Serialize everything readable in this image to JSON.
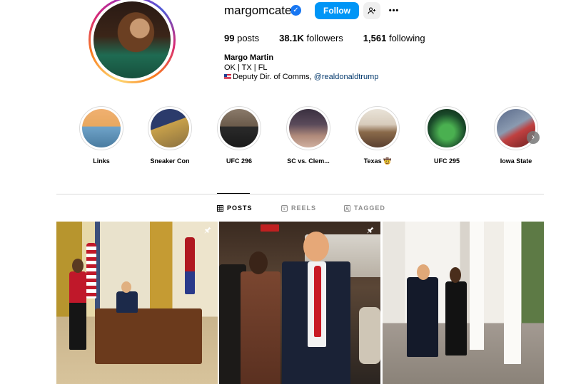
{
  "profile": {
    "username": "margomcatee",
    "verified_glyph": "✓",
    "follow_label": "Follow",
    "more_glyph": "•••",
    "stats": [
      {
        "count": "99",
        "label": "posts"
      },
      {
        "count": "38.1K",
        "label": "followers"
      },
      {
        "count": "1,561",
        "label": "following"
      }
    ],
    "bio": {
      "name": "Margo Martin",
      "line1": "OK | TX | FL",
      "line2_prefix": "Deputy Dir. of Comms, ",
      "line2_link": "@realdonaldtrump"
    }
  },
  "highlights": [
    {
      "label": "Links",
      "colors": [
        "#e8a860",
        "#6fa3c9"
      ]
    },
    {
      "label": "Sneaker Con",
      "colors": [
        "#2b3b6b",
        "#c8a14a"
      ]
    },
    {
      "label": "UFC 296",
      "colors": [
        "#6a5a4a",
        "#2a2a2a"
      ]
    },
    {
      "label": "SC vs. Clem...",
      "colors": [
        "#3a3040",
        "#b08a7a"
      ]
    },
    {
      "label": "Texas 🤠",
      "colors": [
        "#e9e3d8",
        "#8a6a4a"
      ]
    },
    {
      "label": "UFC 295",
      "colors": [
        "#1a4a2a",
        "#4ab050"
      ]
    },
    {
      "label": "Iowa State",
      "colors": [
        "#5a6a8a",
        "#c04040"
      ]
    }
  ],
  "tabs": [
    {
      "label": "POSTS",
      "icon": "grid-icon",
      "active": true
    },
    {
      "label": "REELS",
      "icon": "reels-icon",
      "active": false
    },
    {
      "label": "TAGGED",
      "icon": "tagged-icon",
      "active": false
    }
  ],
  "posts": [
    {
      "pinned": true
    },
    {
      "pinned": true
    },
    {
      "pinned": false
    }
  ],
  "colors": {
    "accent": "#0095f6",
    "verified": "#1877f2",
    "link": "#00376b",
    "muted": "#8e8e8e"
  }
}
